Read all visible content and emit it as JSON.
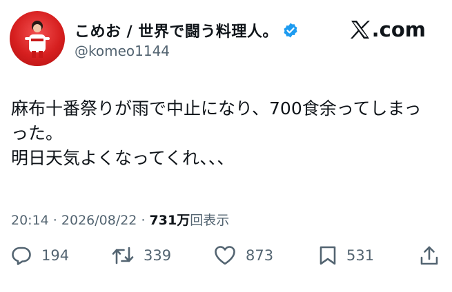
{
  "author": {
    "display_name": "こめお / 世界で闘う料理人。",
    "handle": "@komeo1144",
    "verified_icon": "verified-badge-icon",
    "avatar_color": "#d61f1f"
  },
  "brand": {
    "label": ".com",
    "icon": "x-logo-icon"
  },
  "tweet": {
    "lines": [
      "麻布十番祭りが雨で中止になり、700食余ってしまっ",
      "った。",
      "明日天気よくなってくれ、、、"
    ]
  },
  "meta": {
    "time": "20:14",
    "separator1": " · ",
    "date": "2026/08/22",
    "separator2": " · ",
    "views_count": "731万",
    "views_label": "回表示"
  },
  "actions": {
    "reply": {
      "icon": "reply-icon",
      "count": "194"
    },
    "repost": {
      "icon": "repost-icon",
      "count": "339"
    },
    "like": {
      "icon": "heart-icon",
      "count": "873"
    },
    "bookmark": {
      "icon": "bookmark-icon",
      "count": "531"
    },
    "share": {
      "icon": "share-icon"
    }
  },
  "colors": {
    "text": "#0f1419",
    "muted": "#536471",
    "verified": "#1d9bf0"
  }
}
